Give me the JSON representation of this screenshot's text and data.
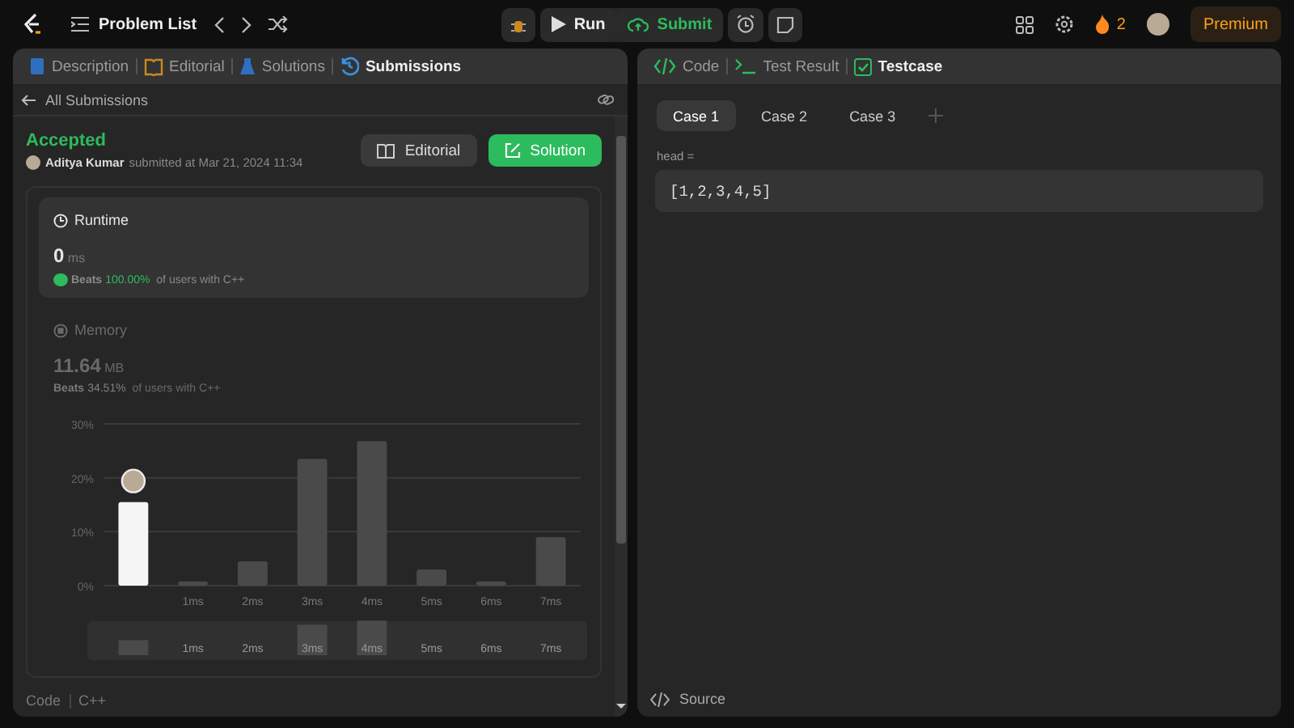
{
  "top_bar": {
    "title": "Problem List",
    "run": "Run",
    "submit": "Submit",
    "streak": "2",
    "premium": "Premium"
  },
  "left_panel": {
    "tabs": [
      {
        "kind": "description",
        "label": "Description",
        "selected": false
      },
      {
        "kind": "editorial",
        "label": "Editorial",
        "selected": false
      },
      {
        "kind": "solutions",
        "label": "Solutions",
        "selected": false
      },
      {
        "kind": "submissions",
        "label": "Submissions",
        "selected": true
      }
    ],
    "back_link": "All Submissions",
    "submission": {
      "status": "Accepted",
      "author": "Aditya Kumar",
      "submitted": "submitted at Mar 21, 2024 11:34",
      "editorial_button": "Editorial",
      "solution_button": "Solution"
    },
    "stats": [
      {
        "kind": "runtime",
        "title": "Runtime",
        "value": "0",
        "unit": "ms",
        "beats": "Beats",
        "percent": "100.00%",
        "suffix": "of users with C++",
        "selected": true
      },
      {
        "kind": "memory",
        "title": "Memory",
        "value": "11.64",
        "unit": "MB",
        "beats": "Beats",
        "percent": "34.51%",
        "suffix": "of users with C++",
        "selected": false
      }
    ],
    "chart_data": {
      "type": "bar",
      "categories": [
        null,
        "1ms",
        "2ms",
        "3ms",
        "4ms",
        "5ms",
        "6ms",
        "7ms"
      ],
      "ylim": [
        0,
        30
      ],
      "yticks": [
        {
          "value": 0,
          "label": "0%"
        },
        {
          "value": 10,
          "label": "10%"
        },
        {
          "value": 20,
          "label": "20%"
        },
        {
          "value": 30,
          "label": "30%"
        }
      ],
      "series": [
        {
          "color": "#f5f5f5",
          "values": [
            15.5,
            null,
            null,
            null,
            null,
            null,
            null,
            null
          ]
        },
        {
          "color": "#4a4a4a",
          "values": [
            null,
            0.8,
            4.5,
            23.5,
            26.8,
            3,
            0.8,
            9
          ]
        }
      ]
    },
    "brush_labels": [
      "1ms",
      "2ms",
      "3ms",
      "4ms",
      "5ms",
      "6ms",
      "7ms"
    ],
    "code_label": "Code",
    "language": "C++"
  },
  "right_panel": {
    "tabs": [
      {
        "kind": "code",
        "label": "Code",
        "selected": false
      },
      {
        "kind": "result",
        "label": "Test Result",
        "selected": false
      },
      {
        "kind": "testcase",
        "label": "Testcase",
        "selected": true
      }
    ],
    "cases": [
      {
        "label": "Case 1",
        "selected": true
      },
      {
        "label": "Case 2",
        "selected": false
      },
      {
        "label": "Case 3",
        "selected": false
      }
    ],
    "param_name": "head =",
    "param_value": "[1,2,3,4,5]",
    "source": "Source"
  }
}
